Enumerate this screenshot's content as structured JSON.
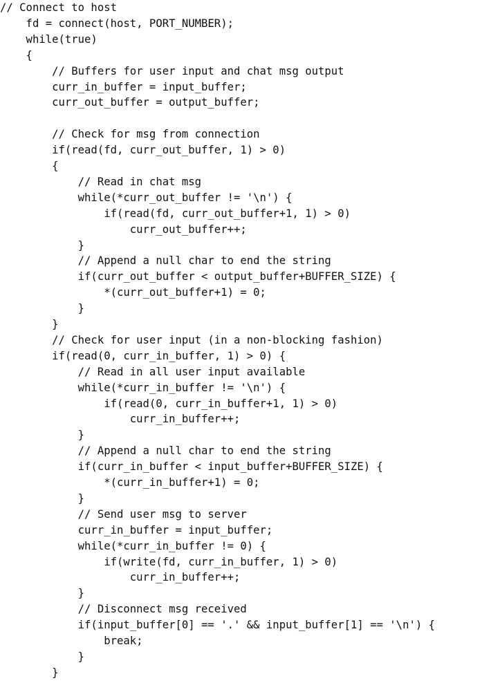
{
  "code": {
    "lines": [
      "// Connect to host",
      "    fd = connect(host, PORT_NUMBER);",
      "    while(true)",
      "    {",
      "        // Buffers for user input and chat msg output",
      "        curr_in_buffer = input_buffer;",
      "        curr_out_buffer = output_buffer;",
      "",
      "        // Check for msg from connection",
      "        if(read(fd, curr_out_buffer, 1) > 0)",
      "        {",
      "            // Read in chat msg",
      "            while(*curr_out_buffer != '\\n') {",
      "                if(read(fd, curr_out_buffer+1, 1) > 0)",
      "                    curr_out_buffer++;",
      "            }",
      "            // Append a null char to end the string",
      "            if(curr_out_buffer < output_buffer+BUFFER_SIZE) {",
      "                *(curr_out_buffer+1) = 0;",
      "            }",
      "        }",
      "        // Check for user input (in a non-blocking fashion)",
      "        if(read(0, curr_in_buffer, 1) > 0) {",
      "            // Read in all user input available",
      "            while(*curr_in_buffer != '\\n') {",
      "                if(read(0, curr_in_buffer+1, 1) > 0)",
      "                    curr_in_buffer++;",
      "            }",
      "            // Append a null char to end the string",
      "            if(curr_in_buffer < input_buffer+BUFFER_SIZE) {",
      "                *(curr_in_buffer+1) = 0;",
      "            }",
      "            // Send user msg to server",
      "            curr_in_buffer = input_buffer;",
      "            while(*curr_in_buffer != 0) {",
      "                if(write(fd, curr_in_buffer, 1) > 0)",
      "                    curr_in_buffer++;",
      "            }",
      "            // Disconnect msg received",
      "            if(input_buffer[0] == '.' && input_buffer[1] == '\\n') {",
      "                break;",
      "            }",
      "        }"
    ]
  }
}
